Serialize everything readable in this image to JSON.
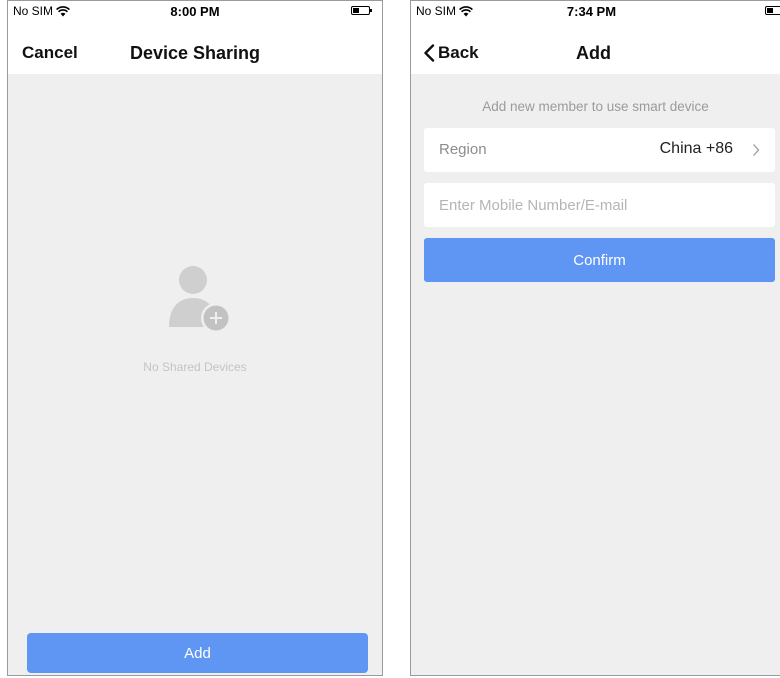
{
  "left_screen": {
    "status_bar": {
      "carrier": "No SIM",
      "time": "8:00 PM"
    },
    "nav": {
      "left_action": "Cancel",
      "title": "Device Sharing"
    },
    "empty_state": {
      "icon": "person-add-icon",
      "text": "No Shared Devices"
    },
    "add_button_label": "Add"
  },
  "right_screen": {
    "status_bar": {
      "carrier": "No SIM",
      "time": "7:34 PM"
    },
    "nav": {
      "back_label": "Back",
      "title": "Add"
    },
    "hint": "Add new member to use smart device",
    "region": {
      "label": "Region",
      "value": "China +86"
    },
    "contact_input": {
      "value": "",
      "placeholder": "Enter Mobile Number/E-mail"
    },
    "confirm_label": "Confirm"
  },
  "colors": {
    "accent": "#5f95f3",
    "background": "#efefef",
    "muted_text": "#c4c4c4"
  }
}
